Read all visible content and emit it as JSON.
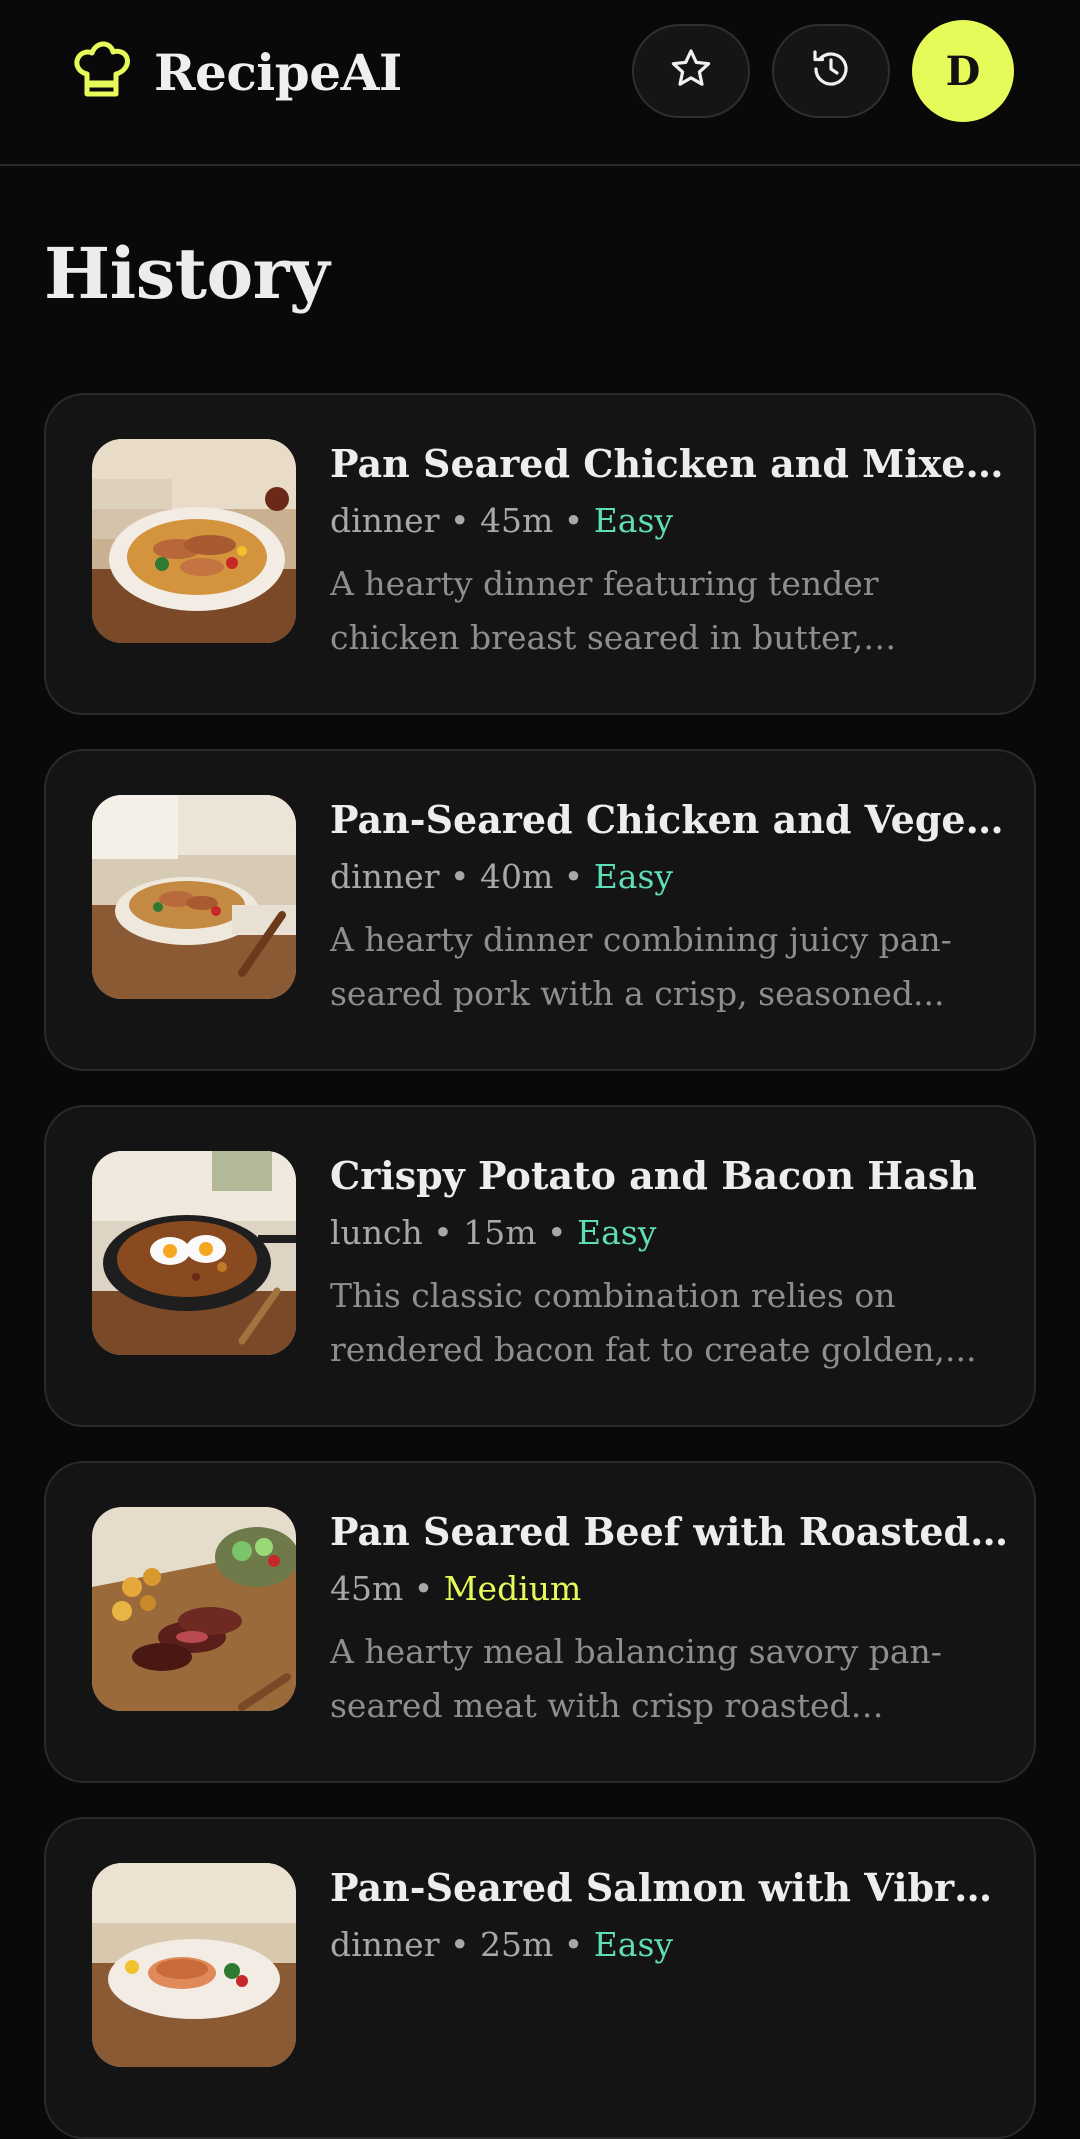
{
  "app": {
    "name": "RecipeAI",
    "logo_icon": "chef-hat-icon",
    "accent_color": "#e6fa59",
    "easy_color": "#5fdcb8"
  },
  "header": {
    "favorites_icon": "star-icon",
    "history_icon": "history-clock-icon",
    "avatar_initial": "D"
  },
  "page": {
    "title": "History"
  },
  "recipes": [
    {
      "title": "Pan Seared Chicken and Mixed...",
      "category": "dinner",
      "time": "45m",
      "difficulty": "Easy",
      "description": "A hearty dinner featuring tender chicken breast seared in butter, paired..."
    },
    {
      "title": "Pan-Seared Chicken and Vegeta...",
      "category": "dinner",
      "time": "40m",
      "difficulty": "Easy",
      "description": "A hearty dinner combining juicy pan-seared pork with a crisp, seasoned..."
    },
    {
      "title": "Crispy Potato and Bacon Hash",
      "category": "lunch",
      "time": "15m",
      "difficulty": "Easy",
      "description": "This classic combination relies on rendered bacon fat to create golden,..."
    },
    {
      "title": "Pan Seared Beef with Roasted ...",
      "category": "",
      "time": "45m",
      "difficulty": "Medium",
      "description": "A hearty meal balancing savory pan-seared meat with crisp roasted potatoe..."
    },
    {
      "title": "Pan-Seared Salmon with Vibra...",
      "category": "dinner",
      "time": "25m",
      "difficulty": "Easy",
      "description": ""
    }
  ]
}
